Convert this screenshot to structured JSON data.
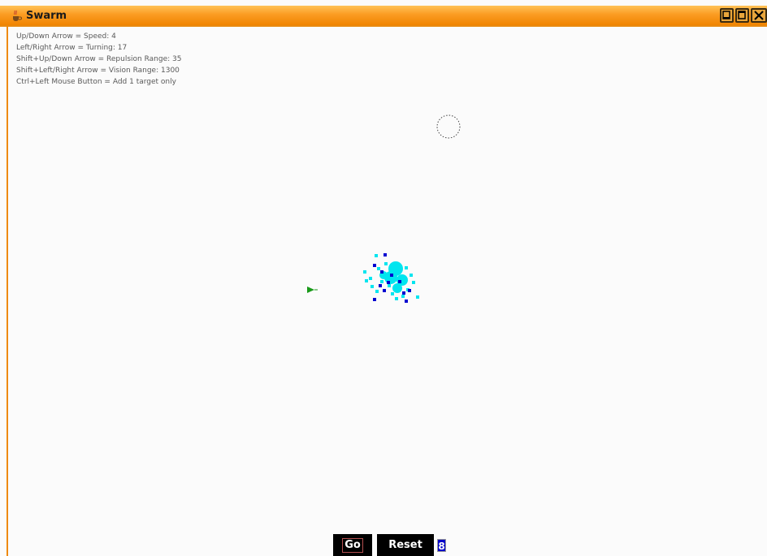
{
  "window": {
    "title": "Swarm",
    "accent_color": "#f39a1f",
    "title_icon": "java-coffee-icon",
    "buttons": [
      "minimize-icon",
      "maximize-icon",
      "close-icon"
    ]
  },
  "info_lines": [
    "Up/Down Arrow = Speed: 4",
    "Left/Right Arrow = Turning: 17",
    "Shift+Up/Down Arrow = Repulsion Range: 35",
    "Shift+Left/Right Arrow = Vision Range: 1300",
    "Ctrl+Left Mouse Button = Add 1 target only"
  ],
  "simulation": {
    "agent_colors": {
      "cyan": "#00e5ef",
      "blue": "#0000d0",
      "target": "#1a9a1a"
    }
  },
  "controls": {
    "go_label": "Go",
    "reset_label": "Reset",
    "count_value": "8"
  }
}
